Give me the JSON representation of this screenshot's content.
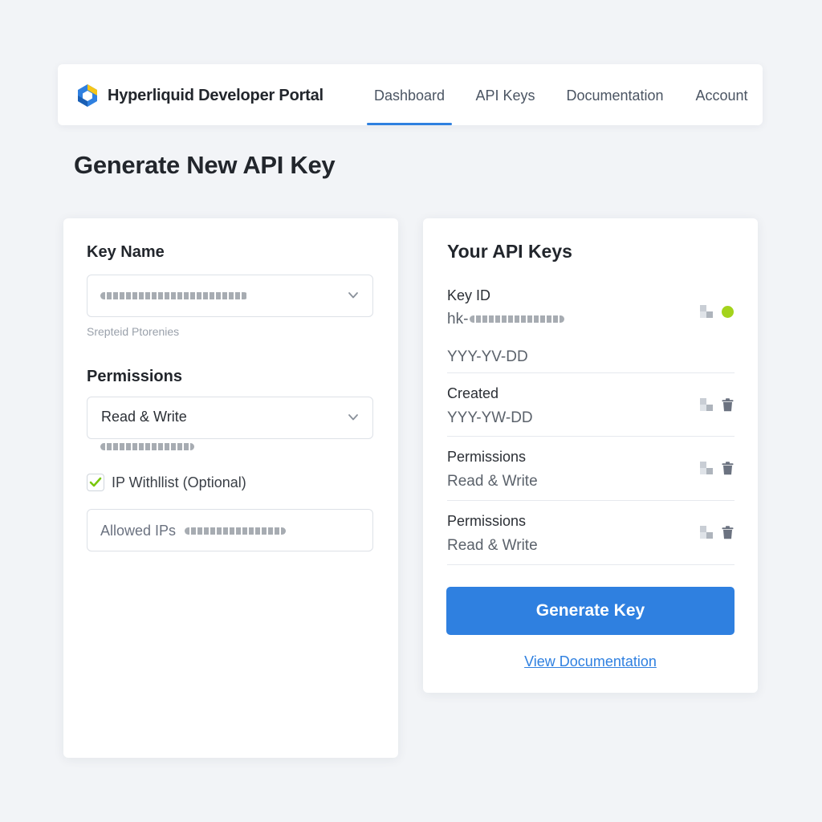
{
  "header": {
    "brand_name": "Hyperliquid Developer Portal",
    "logo_icon": "hexagon-logo-icon",
    "tabs": [
      {
        "label": "Dashboard",
        "active": true
      },
      {
        "label": "API Keys",
        "active": false
      },
      {
        "label": "Documentation",
        "active": false
      },
      {
        "label": "Account",
        "active": false
      }
    ]
  },
  "page": {
    "title": "Generate New API Key"
  },
  "form": {
    "key_name_label": "Key Name",
    "key_name_helper": "Srepteid Ptorenies",
    "permissions_label": "Permissions",
    "permissions_value": "Read & Write",
    "ip_whitelist_label": "IP Withllist (Optional)",
    "ip_whitelist_checked": true,
    "allowed_ips_placeholder": "Allowed IPs"
  },
  "keys_panel": {
    "title": "Your API Keys",
    "rows": [
      {
        "label": "Key ID",
        "value": "hk-",
        "extra": "YYY-YV-DD"
      },
      {
        "label": "Created",
        "value": "YYY-YW-DD"
      },
      {
        "label": "Permissions",
        "value": "Read & Write"
      },
      {
        "label": "Permissions",
        "value": "Read & Write"
      }
    ],
    "generate_label": "Generate Key",
    "docs_link": "View Documentation"
  },
  "colors": {
    "accent": "#2f80e0",
    "status_active": "#a4d31c",
    "checkbox_check": "#7ac70c",
    "logo_blue": "#2f80e0",
    "logo_yellow": "#f5c518"
  }
}
